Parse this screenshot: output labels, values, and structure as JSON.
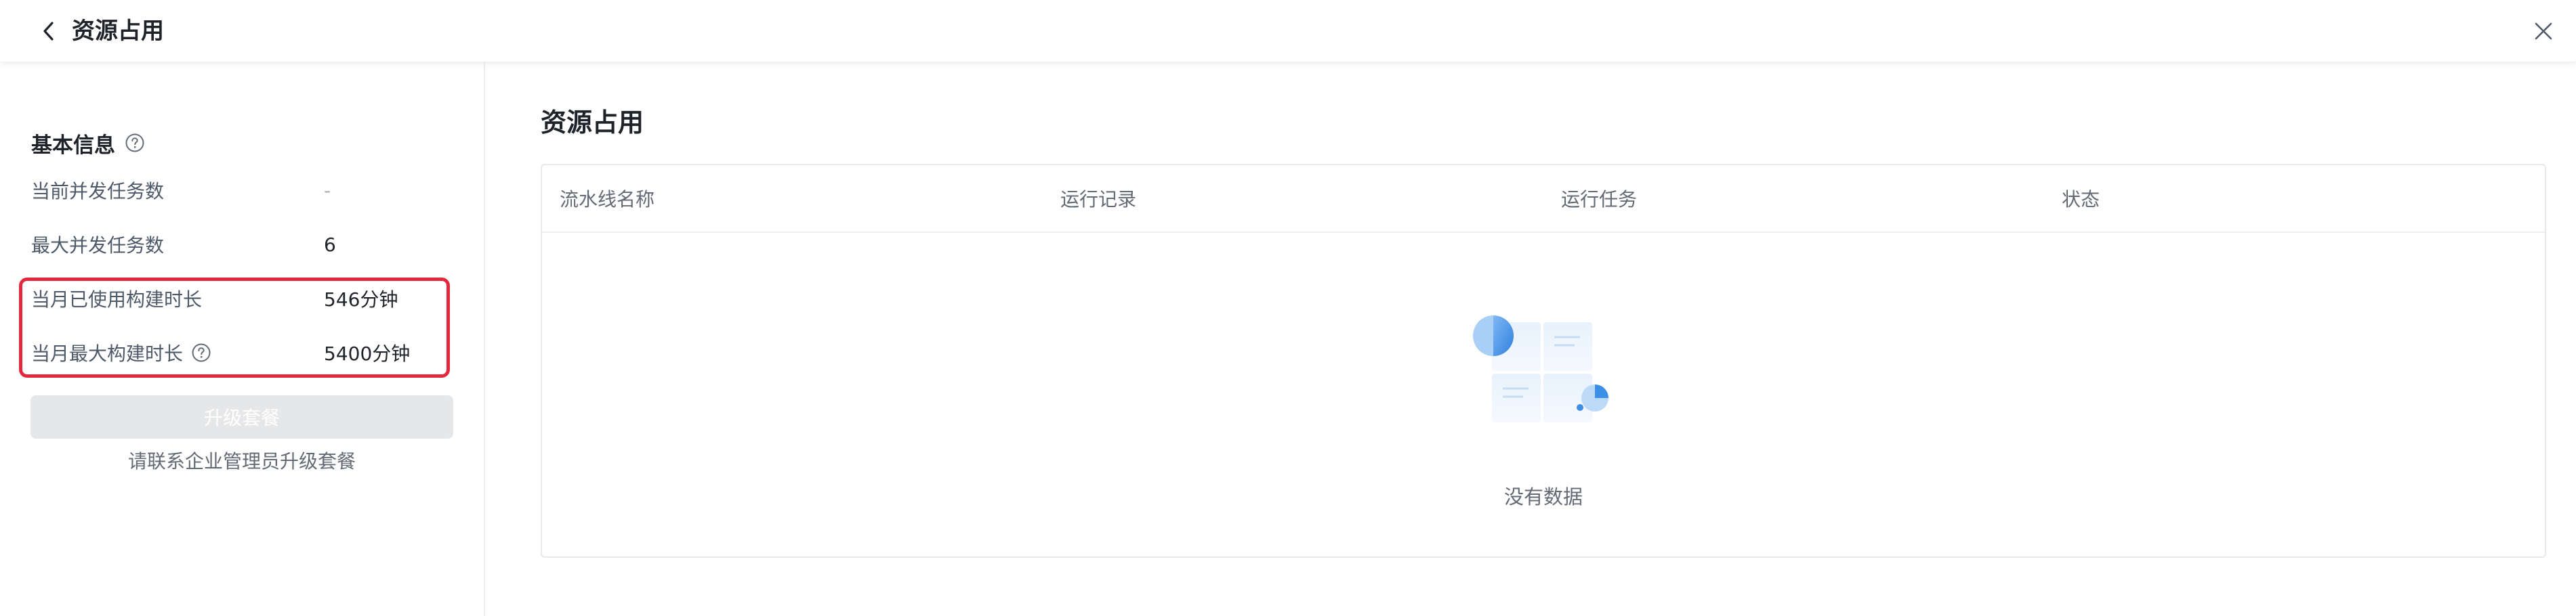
{
  "header": {
    "title": "资源占用"
  },
  "basic_info": {
    "title": "基本信息",
    "rows": [
      {
        "label": "当前并发任务数",
        "value": "-"
      },
      {
        "label": "最大并发任务数",
        "value": "6"
      },
      {
        "label": "当月已使用构建时长",
        "value": "546分钟"
      },
      {
        "label": "当月最大构建时长",
        "value": "5400分钟"
      }
    ],
    "upgrade_label": "升级套餐",
    "contact_note": "请联系企业管理员升级套餐"
  },
  "main": {
    "title": "资源占用",
    "columns": [
      "流水线名称",
      "运行记录",
      "运行任务",
      "状态"
    ],
    "empty_text": "没有数据"
  },
  "colors": {
    "highlight_border": "#e3273d",
    "upgrade_disabled_bg": "#e6e7e9",
    "illustration_blue": "#3b8fe6"
  },
  "icons": [
    "chevron-left-icon",
    "close-icon",
    "question-circle-icon",
    "empty-data-illustration"
  ]
}
